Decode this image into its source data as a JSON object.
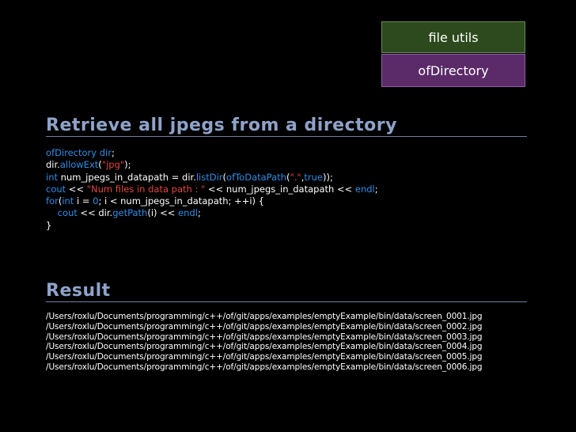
{
  "tags": {
    "top": "file utils",
    "bottom": "ofDirectory"
  },
  "section1": {
    "title": "Retrieve all jpegs from a directory"
  },
  "code": [
    [
      {
        "t": "ofDirectory dir",
        "c": "kw"
      },
      {
        "t": ";",
        "c": ""
      }
    ],
    [
      {
        "t": "dir.",
        "c": ""
      },
      {
        "t": "allowExt",
        "c": "kw"
      },
      {
        "t": "(",
        "c": ""
      },
      {
        "t": "\"jpg\"",
        "c": "str"
      },
      {
        "t": ");",
        "c": ""
      }
    ],
    [
      {
        "t": "int",
        "c": "kw"
      },
      {
        "t": " num_jpegs_in_datapath = dir.",
        "c": ""
      },
      {
        "t": "listDir",
        "c": "kw"
      },
      {
        "t": "(",
        "c": ""
      },
      {
        "t": "ofToDataPath",
        "c": "kw"
      },
      {
        "t": "(",
        "c": ""
      },
      {
        "t": "\".\"",
        "c": "str"
      },
      {
        "t": ",",
        "c": ""
      },
      {
        "t": "true",
        "c": "kw"
      },
      {
        "t": "));",
        "c": ""
      }
    ],
    [
      {
        "t": "cout",
        "c": "kw"
      },
      {
        "t": " << ",
        "c": ""
      },
      {
        "t": "\"Num files in data path : \"",
        "c": "str"
      },
      {
        "t": " << num_jpegs_in_datapath << ",
        "c": ""
      },
      {
        "t": "endl",
        "c": "kw"
      },
      {
        "t": ";",
        "c": ""
      }
    ],
    [
      {
        "t": "for",
        "c": "kw"
      },
      {
        "t": "(",
        "c": ""
      },
      {
        "t": "int",
        "c": "kw"
      },
      {
        "t": " i = ",
        "c": ""
      },
      {
        "t": "0",
        "c": "num"
      },
      {
        "t": "; i < num_jpegs_in_datapath; ++i) {",
        "c": ""
      }
    ],
    [
      {
        "t": "    ",
        "c": ""
      },
      {
        "t": "cout",
        "c": "kw"
      },
      {
        "t": " << dir.",
        "c": ""
      },
      {
        "t": "getPath",
        "c": "kw"
      },
      {
        "t": "(i) << ",
        "c": ""
      },
      {
        "t": "endl",
        "c": "kw"
      },
      {
        "t": ";",
        "c": ""
      }
    ],
    [
      {
        "t": "}",
        "c": ""
      }
    ]
  ],
  "section2": {
    "title": "Result"
  },
  "results": [
    "/Users/roxlu/Documents/programming/c++/of/git/apps/examples/emptyExample/bin/data/screen_0001.jpg",
    "/Users/roxlu/Documents/programming/c++/of/git/apps/examples/emptyExample/bin/data/screen_0002.jpg",
    "/Users/roxlu/Documents/programming/c++/of/git/apps/examples/emptyExample/bin/data/screen_0003.jpg",
    "/Users/roxlu/Documents/programming/c++/of/git/apps/examples/emptyExample/bin/data/screen_0004.jpg",
    "/Users/roxlu/Documents/programming/c++/of/git/apps/examples/emptyExample/bin/data/screen_0005.jpg",
    "/Users/roxlu/Documents/programming/c++/of/git/apps/examples/emptyExample/bin/data/screen_0006.jpg"
  ],
  "colors": {
    "background": "#000000",
    "heading": "#8fa3c9",
    "keyword": "#2f8de6",
    "string": "#e2473f",
    "tag_top_bg": "#2d4a1e",
    "tag_bottom_bg": "#5b2a68"
  }
}
